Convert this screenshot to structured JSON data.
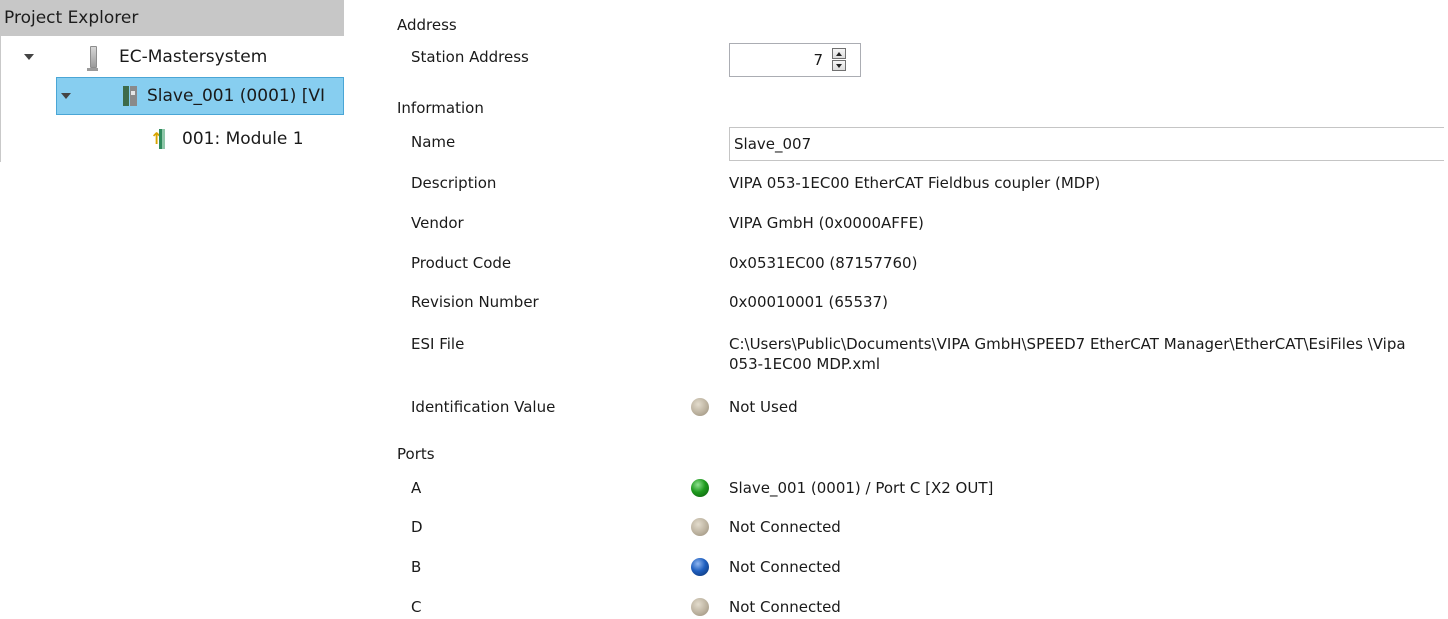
{
  "explorer": {
    "title": "Project Explorer",
    "tree": {
      "master": "EC-Mastersystem",
      "slave": "Slave_001 (0001) [VI",
      "module": "001: Module 1"
    }
  },
  "address": {
    "section_label": "Address",
    "station_address_label": "Station Address",
    "station_address_value": "7"
  },
  "information": {
    "section_label": "Information",
    "name_label": "Name",
    "name_value": "Slave_007",
    "description_label": "Description",
    "description_value": "VIPA 053-1EC00 EtherCAT Fieldbus coupler (MDP)",
    "vendor_label": "Vendor",
    "vendor_value": "VIPA GmbH (0x0000AFFE)",
    "product_code_label": "Product Code",
    "product_code_value": "0x0531EC00 (87157760)",
    "revision_label": "Revision Number",
    "revision_value": "0x00010001 (65537)",
    "esi_file_label": "ESI File",
    "esi_file_value": "C:\\Users\\Public\\Documents\\VIPA GmbH\\SPEED7 EtherCAT Manager\\EtherCAT\\EsiFiles \\Vipa 053-1EC00 MDP.xml",
    "identification_label": "Identification Value",
    "identification_value": "Not Used",
    "identification_status_color": "#bcb29f"
  },
  "ports": {
    "section_label": "Ports",
    "items": [
      {
        "label": "A",
        "value": "Slave_001 (0001) / Port C [X2 OUT]",
        "status": "green",
        "color": "#1f9a1f"
      },
      {
        "label": "D",
        "value": "Not Connected",
        "status": "grey",
        "color": "#bcb29f"
      },
      {
        "label": "B",
        "value": "Not Connected",
        "status": "blue",
        "color": "#1f5fbf"
      },
      {
        "label": "C",
        "value": "Not Connected",
        "status": "grey",
        "color": "#bcb29f"
      }
    ]
  }
}
